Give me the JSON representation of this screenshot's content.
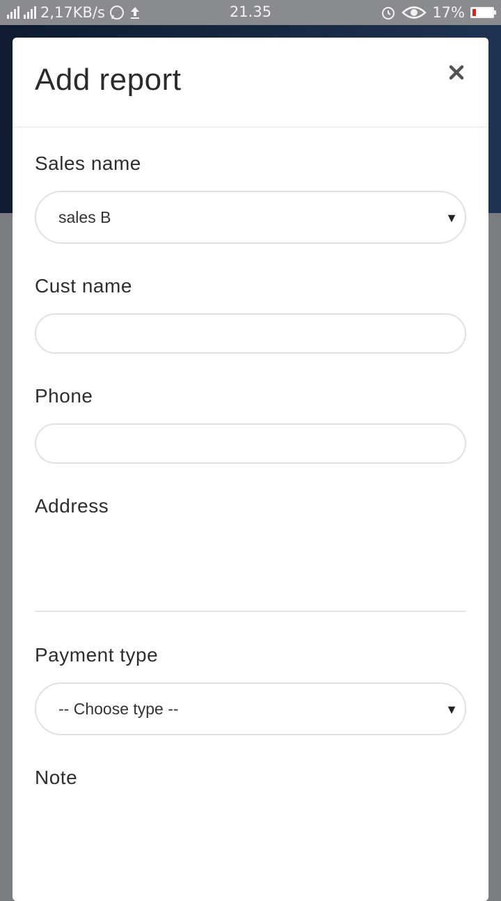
{
  "status_bar": {
    "network_speed": "2,17KB/s",
    "time": "21.35",
    "battery": "17%",
    "battery_level": 0.17
  },
  "modal": {
    "title": "Add report",
    "fields": {
      "sales_name": {
        "label": "Sales name",
        "value": "sales B"
      },
      "cust_name": {
        "label": "Cust name",
        "value": ""
      },
      "phone": {
        "label": "Phone",
        "value": ""
      },
      "address": {
        "label": "Address",
        "value": ""
      },
      "payment_type": {
        "label": "Payment type",
        "value": "-- Choose type --"
      },
      "note": {
        "label": "Note",
        "value": ""
      }
    }
  },
  "icons": [
    "signal-icon",
    "whatsapp-icon",
    "upload-icon",
    "alarm-icon",
    "eye-icon",
    "battery-icon",
    "close-icon",
    "chevron-down-icon"
  ]
}
